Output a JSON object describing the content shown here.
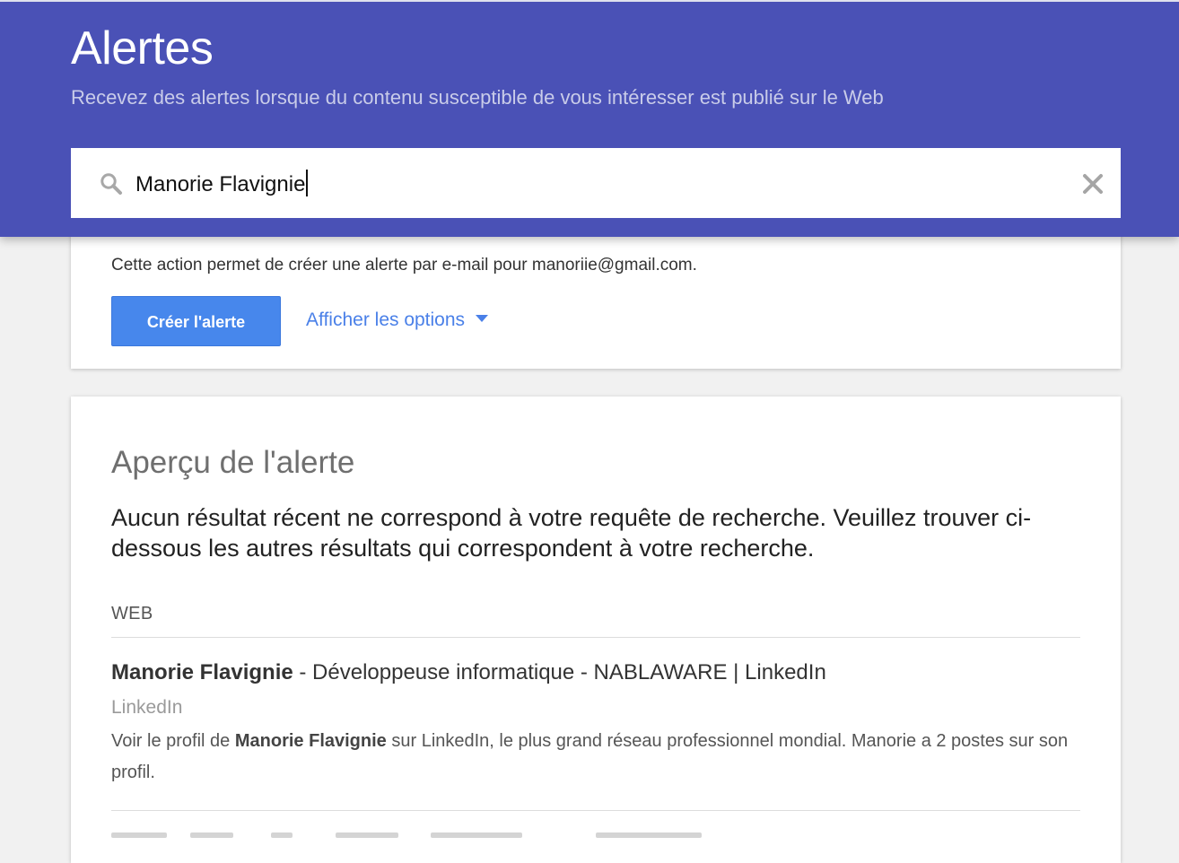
{
  "header": {
    "title": "Alertes",
    "subtitle": "Recevez des alertes lorsque du contenu susceptible de vous intéresser est publié sur le Web",
    "background_color": "#4a51b6"
  },
  "search": {
    "value": "Manorie Flavignie",
    "icon": "search-icon",
    "clear_icon": "close-icon"
  },
  "create_alert": {
    "info": "Cette action permet de créer une alerte par e-mail pour manoriie@gmail.com.",
    "button_label": "Créer l'alerte",
    "options_label": "Afficher les options",
    "options_icon": "caret-down-icon",
    "button_color": "#4787ec",
    "link_color": "#4a80e8"
  },
  "preview": {
    "title": "Aperçu de l'alerte",
    "no_results_message": "Aucun résultat récent ne correspond à votre requête de recherche. Veuillez trouver ci-dessous les autres résultats qui correspondent à votre recherche.",
    "section_label": "WEB",
    "results": [
      {
        "title_strong": "Manorie Flavignie",
        "title_rest": " - Développeuse informatique - NABLAWARE | LinkedIn",
        "source": "LinkedIn",
        "snippet_before": "Voir le profil de ",
        "snippet_strong": "Manorie Flavignie",
        "snippet_after": " sur LinkedIn, le plus grand réseau professionnel mondial. Manorie a 2 postes sur son profil."
      }
    ]
  }
}
